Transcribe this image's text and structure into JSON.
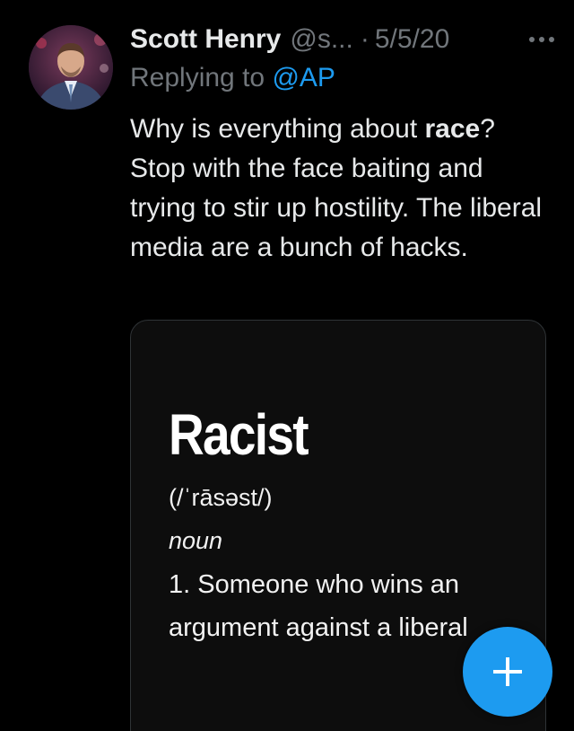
{
  "tweet": {
    "author_name": "Scott Henry",
    "author_handle": "@s...",
    "separator": "·",
    "date": "5/5/20",
    "reply_prefix": "Replying to",
    "reply_mention": "@AP",
    "text_before_bold": "Why is everything about ",
    "text_bold": "race",
    "text_after_bold": "? Stop with the face baiting and trying to stir up hostility. The liberal media are a bunch of hacks."
  },
  "media": {
    "word": "Racist",
    "pronunciation": "(/ˈrāsəst/)",
    "part_of_speech": "noun",
    "definition_line1": "1. Someone who wins an",
    "definition_line2": "argument against a liberal"
  },
  "icons": {
    "more": "more-horizontal-icon",
    "compose": "plus-icon"
  },
  "colors": {
    "background": "#000000",
    "accent": "#1d9bf0",
    "text_primary": "#e7e9ea",
    "text_secondary": "#71767b"
  }
}
